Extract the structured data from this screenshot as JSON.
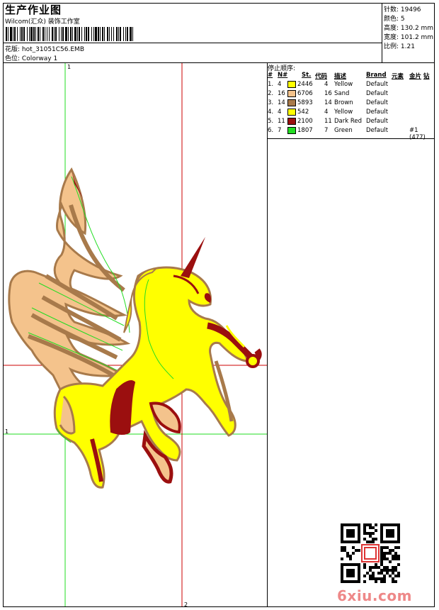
{
  "header": {
    "title": "生产作业图",
    "company": "Wilcom(汇众) 装饰工作室",
    "design_label": "花版: ",
    "design_value": "hot_31051C56.EMB",
    "colorway_label": "色位: ",
    "colorway_value": "Colorway 1"
  },
  "stats": [
    {
      "label": "针数: ",
      "value": "19496"
    },
    {
      "label": "颜色: ",
      "value": "5"
    },
    {
      "label": "高度: ",
      "value": "130.2 mm"
    },
    {
      "label": "宽度: ",
      "value": "101.2 mm"
    },
    {
      "label": "比例: ",
      "value": "1.21"
    }
  ],
  "stop_sequence_title": "停止顺序:",
  "table": {
    "headers": {
      "num": "#",
      "n": "N#",
      "st": "St.",
      "code": "代码",
      "desc": "描述",
      "brand": "Brand",
      "element": "元素",
      "sequin": "金片",
      "sequin2": "钻"
    },
    "rows": [
      {
        "idx": "1.",
        "n": "4",
        "st": "2446",
        "code": "4",
        "desc": "Yellow",
        "brand": "Default",
        "extra": "",
        "color": "#ffff00"
      },
      {
        "idx": "2.",
        "n": "16",
        "st": "6706",
        "code": "16",
        "desc": "Sand",
        "brand": "Default",
        "extra": "",
        "color": "#f4c38c"
      },
      {
        "idx": "3.",
        "n": "14",
        "st": "5893",
        "code": "14",
        "desc": "Brown",
        "brand": "Default",
        "extra": "",
        "color": "#a87a4b"
      },
      {
        "idx": "4.",
        "n": "4",
        "st": "542",
        "code": "4",
        "desc": "Yellow",
        "brand": "Default",
        "extra": "",
        "color": "#ffff00"
      },
      {
        "idx": "5.",
        "n": "11",
        "st": "2100",
        "code": "11",
        "desc": "Dark Red",
        "brand": "Default",
        "extra": "",
        "color": "#9b0f0f"
      },
      {
        "idx": "6.",
        "n": "7",
        "st": "1807",
        "code": "7",
        "desc": "Green",
        "brand": "Default",
        "extra": "#1 (477)",
        "color": "#22dd22"
      }
    ]
  },
  "marks": {
    "top": "1",
    "left": "1",
    "bottom": "2"
  },
  "watermark": "6xiu.com",
  "colors": {
    "yellow": "#ffff00",
    "sand": "#f4c38c",
    "brown": "#a87a4b",
    "darkred": "#9b0f0f",
    "green": "#22dd22",
    "red": "#cc0000"
  }
}
